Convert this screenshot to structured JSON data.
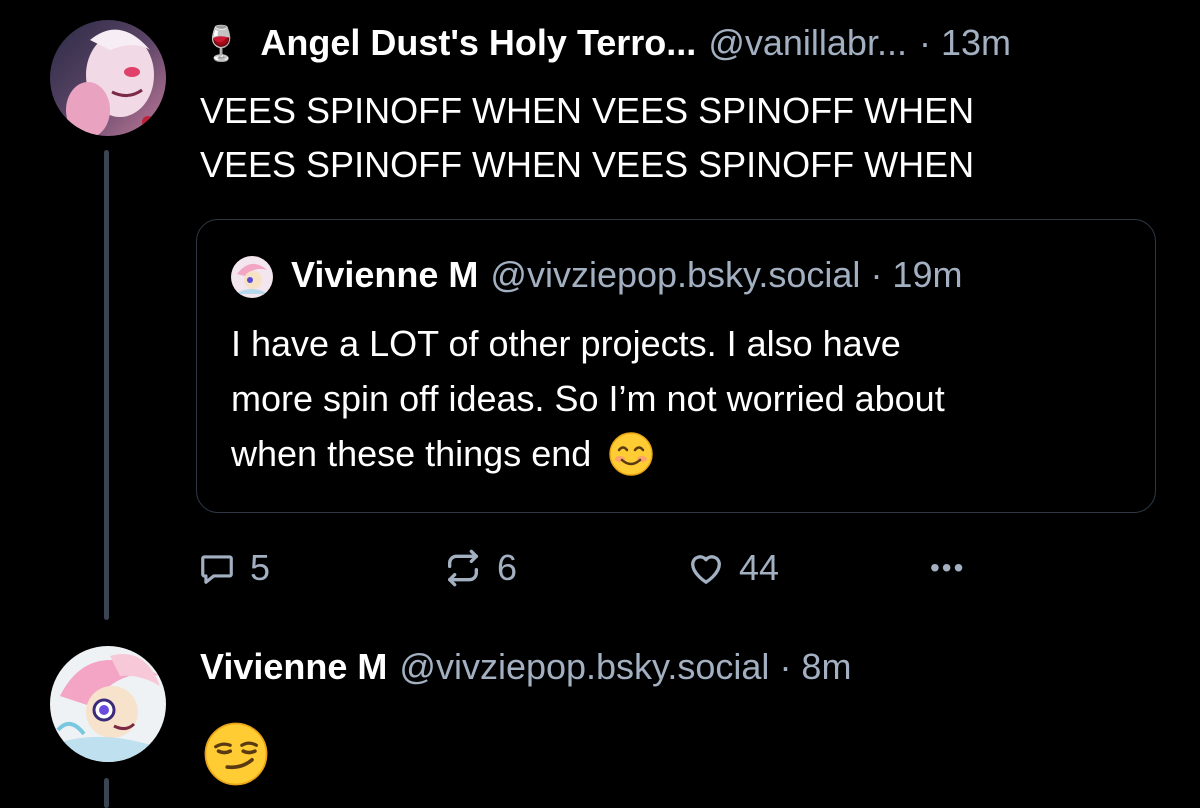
{
  "post1": {
    "name_emoji": "🍷",
    "display_name": "Angel Dust's Holy Terro...",
    "handle": "@vanillabr...",
    "time": "· 13m",
    "lines": [
      "VEES SPINOFF WHEN VEES SPINOFF WHEN",
      "VEES SPINOFF WHEN VEES SPINOFF WHEN"
    ],
    "quote": {
      "display_name": "Vivienne M",
      "handle": "@vivziepop.bsky.social",
      "time": "· 19m",
      "lines": [
        "I have a LOT of other projects. I also have",
        "more spin off ideas. So I’m not worried about",
        "when these things end"
      ],
      "emoji": "smiling-face-emoji"
    },
    "actions": {
      "replies": "5",
      "reposts": "6",
      "likes": "44",
      "more": "•••"
    }
  },
  "post2": {
    "display_name": "Vivienne M",
    "handle": "@vivziepop.bsky.social",
    "time": "· 8m",
    "emoji": "smirking-face-emoji"
  },
  "colors": {
    "background": "#000000",
    "text": "#ffffff",
    "muted": "#a3b0c1",
    "thread_line": "#3a4452",
    "quote_border": "#2e3845"
  }
}
